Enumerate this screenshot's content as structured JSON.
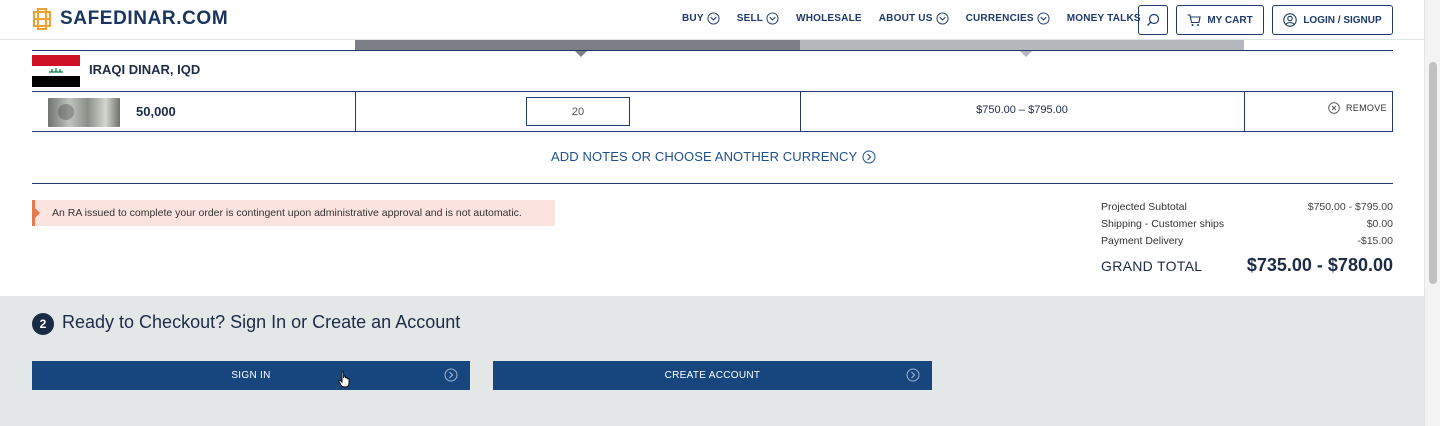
{
  "header": {
    "logo_text": "SAFEDINAR.COM",
    "nav": [
      {
        "label": "BUY",
        "has_chevron": true
      },
      {
        "label": "SELL",
        "has_chevron": true
      },
      {
        "label": "WHOLESALE",
        "has_chevron": false
      },
      {
        "label": "ABOUT US",
        "has_chevron": true
      },
      {
        "label": "CURRENCIES",
        "has_chevron": true
      },
      {
        "label": "MONEY TALKS",
        "has_chevron": false
      }
    ],
    "cart_label": "MY CART",
    "login_label": "LOGIN / SIGNUP"
  },
  "cart": {
    "currency_name": "IRAQI DINAR, IQD",
    "item": {
      "denomination": "50,000",
      "quantity": "20",
      "price_range": "$750.00 – $795.00",
      "remove_label": "REMOVE"
    },
    "add_notes_label": "ADD NOTES OR CHOOSE ANOTHER CURRENCY"
  },
  "notice": "An RA issued to complete your order is contingent upon administrative approval and is not automatic.",
  "totals": {
    "rows": [
      {
        "label": "Projected Subtotal",
        "value": "$750.00 - $795.00"
      },
      {
        "label": "Shipping - Customer ships",
        "value": "$0.00"
      },
      {
        "label": "Payment Delivery",
        "value": "-$15.00"
      }
    ],
    "grand_label": "GRAND TOTAL",
    "grand_value": "$735.00 - $780.00"
  },
  "checkout": {
    "step": "2",
    "title": "Ready to Checkout? Sign In or Create an Account",
    "signin_label": "SIGN IN",
    "create_label": "CREATE ACCOUNT"
  },
  "colors": {
    "navy": "#1d3a6b",
    "button": "#17467f",
    "logo_orange": "#f0a030",
    "notice_bg": "#fbe3df",
    "notice_accent": "#e7794f",
    "checkout_bg": "#e3e7e8"
  }
}
